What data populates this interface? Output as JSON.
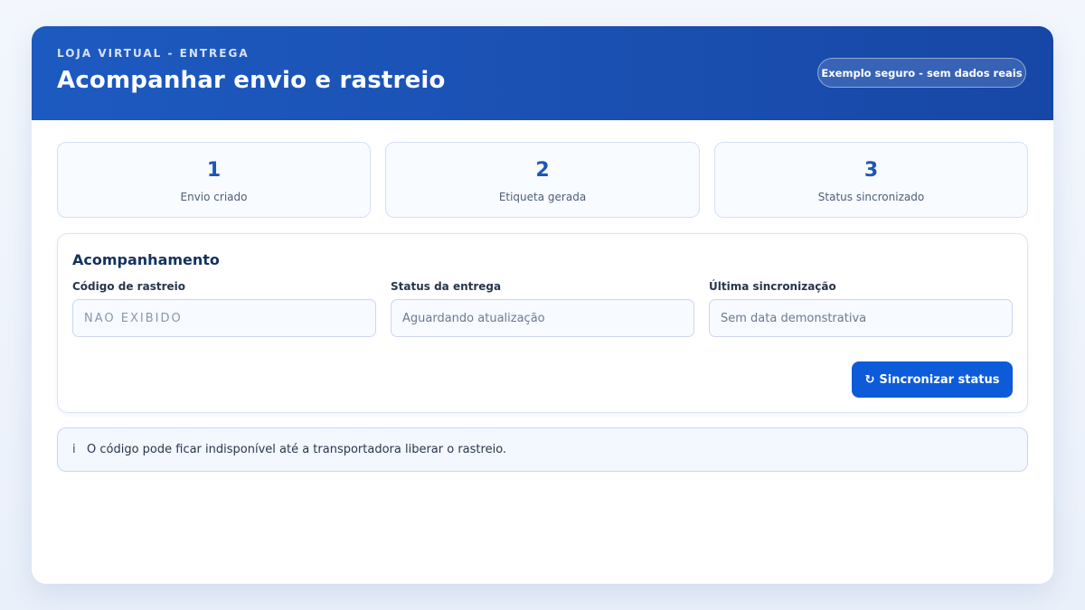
{
  "header": {
    "eyebrow": "LOJA VIRTUAL - ENTREGA",
    "title": "Acompanhar envio e rastreio",
    "badge": "Exemplo seguro - sem dados reais"
  },
  "steps": [
    {
      "number": "1",
      "label": "Envio criado"
    },
    {
      "number": "2",
      "label": "Etiqueta gerada"
    },
    {
      "number": "3",
      "label": "Status sincronizado"
    }
  ],
  "tracking": {
    "title": "Acompanhamento",
    "code": {
      "label": "Código de rastreio",
      "placeholder": "NÃO EXIBIDO"
    },
    "status": {
      "label": "Status da entrega",
      "placeholder": "Aguardando atualização"
    },
    "last_sync": {
      "label": "Última sincronização",
      "placeholder": "Sem data demonstrativa"
    },
    "sync_button": {
      "icon": "refresh-icon",
      "glyph": "↻",
      "label": "Sincronizar status"
    }
  },
  "notice": {
    "icon": "info-icon",
    "glyph": "i",
    "text": "O código pode ficar indisponível até a transportadora liberar o rastreio."
  },
  "colors": {
    "header_bg": "#1d5ac0",
    "accent": "#0d5bd8",
    "step_number": "#1d57b6"
  }
}
